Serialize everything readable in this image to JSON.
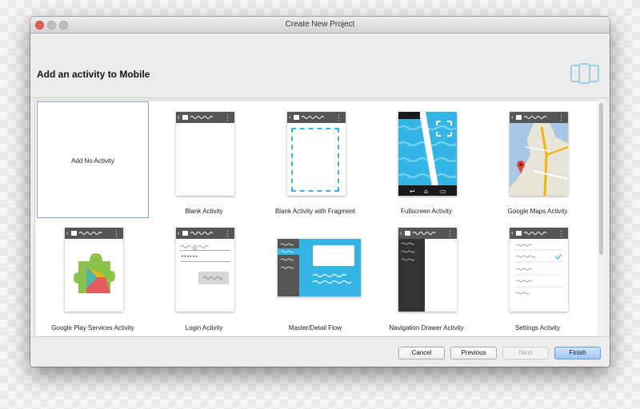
{
  "window": {
    "title": "Create New Project"
  },
  "header": {
    "title": "Add an activity to Mobile",
    "icon": "device-icon"
  },
  "tiles": [
    {
      "label": "Add No Activity",
      "name": "add-no-activity",
      "selected": true
    },
    {
      "label": "Blank Activity",
      "name": "blank-activity"
    },
    {
      "label": "Blank Activity with Fragment",
      "name": "blank-activity-fragment"
    },
    {
      "label": "Fullscreen Activity",
      "name": "fullscreen-activity"
    },
    {
      "label": "Google Maps Activity",
      "name": "google-maps-activity"
    },
    {
      "label": "Google Play Services Activity",
      "name": "google-play-services-activity"
    },
    {
      "label": "Login Activity",
      "name": "login-activity"
    },
    {
      "label": "Master/Detail Flow",
      "name": "master-detail-flow"
    },
    {
      "label": "Navigation Drawer Activity",
      "name": "navigation-drawer-activity"
    },
    {
      "label": "Settings Activity",
      "name": "settings-activity"
    }
  ],
  "login": {
    "password_mask": "••••••"
  },
  "buttons": {
    "cancel": "Cancel",
    "previous": "Previous",
    "next": "Next",
    "finish": "Finish"
  },
  "colors": {
    "accent": "#33b5e5",
    "selection": "#7fa1c6",
    "dark": "#555555"
  }
}
